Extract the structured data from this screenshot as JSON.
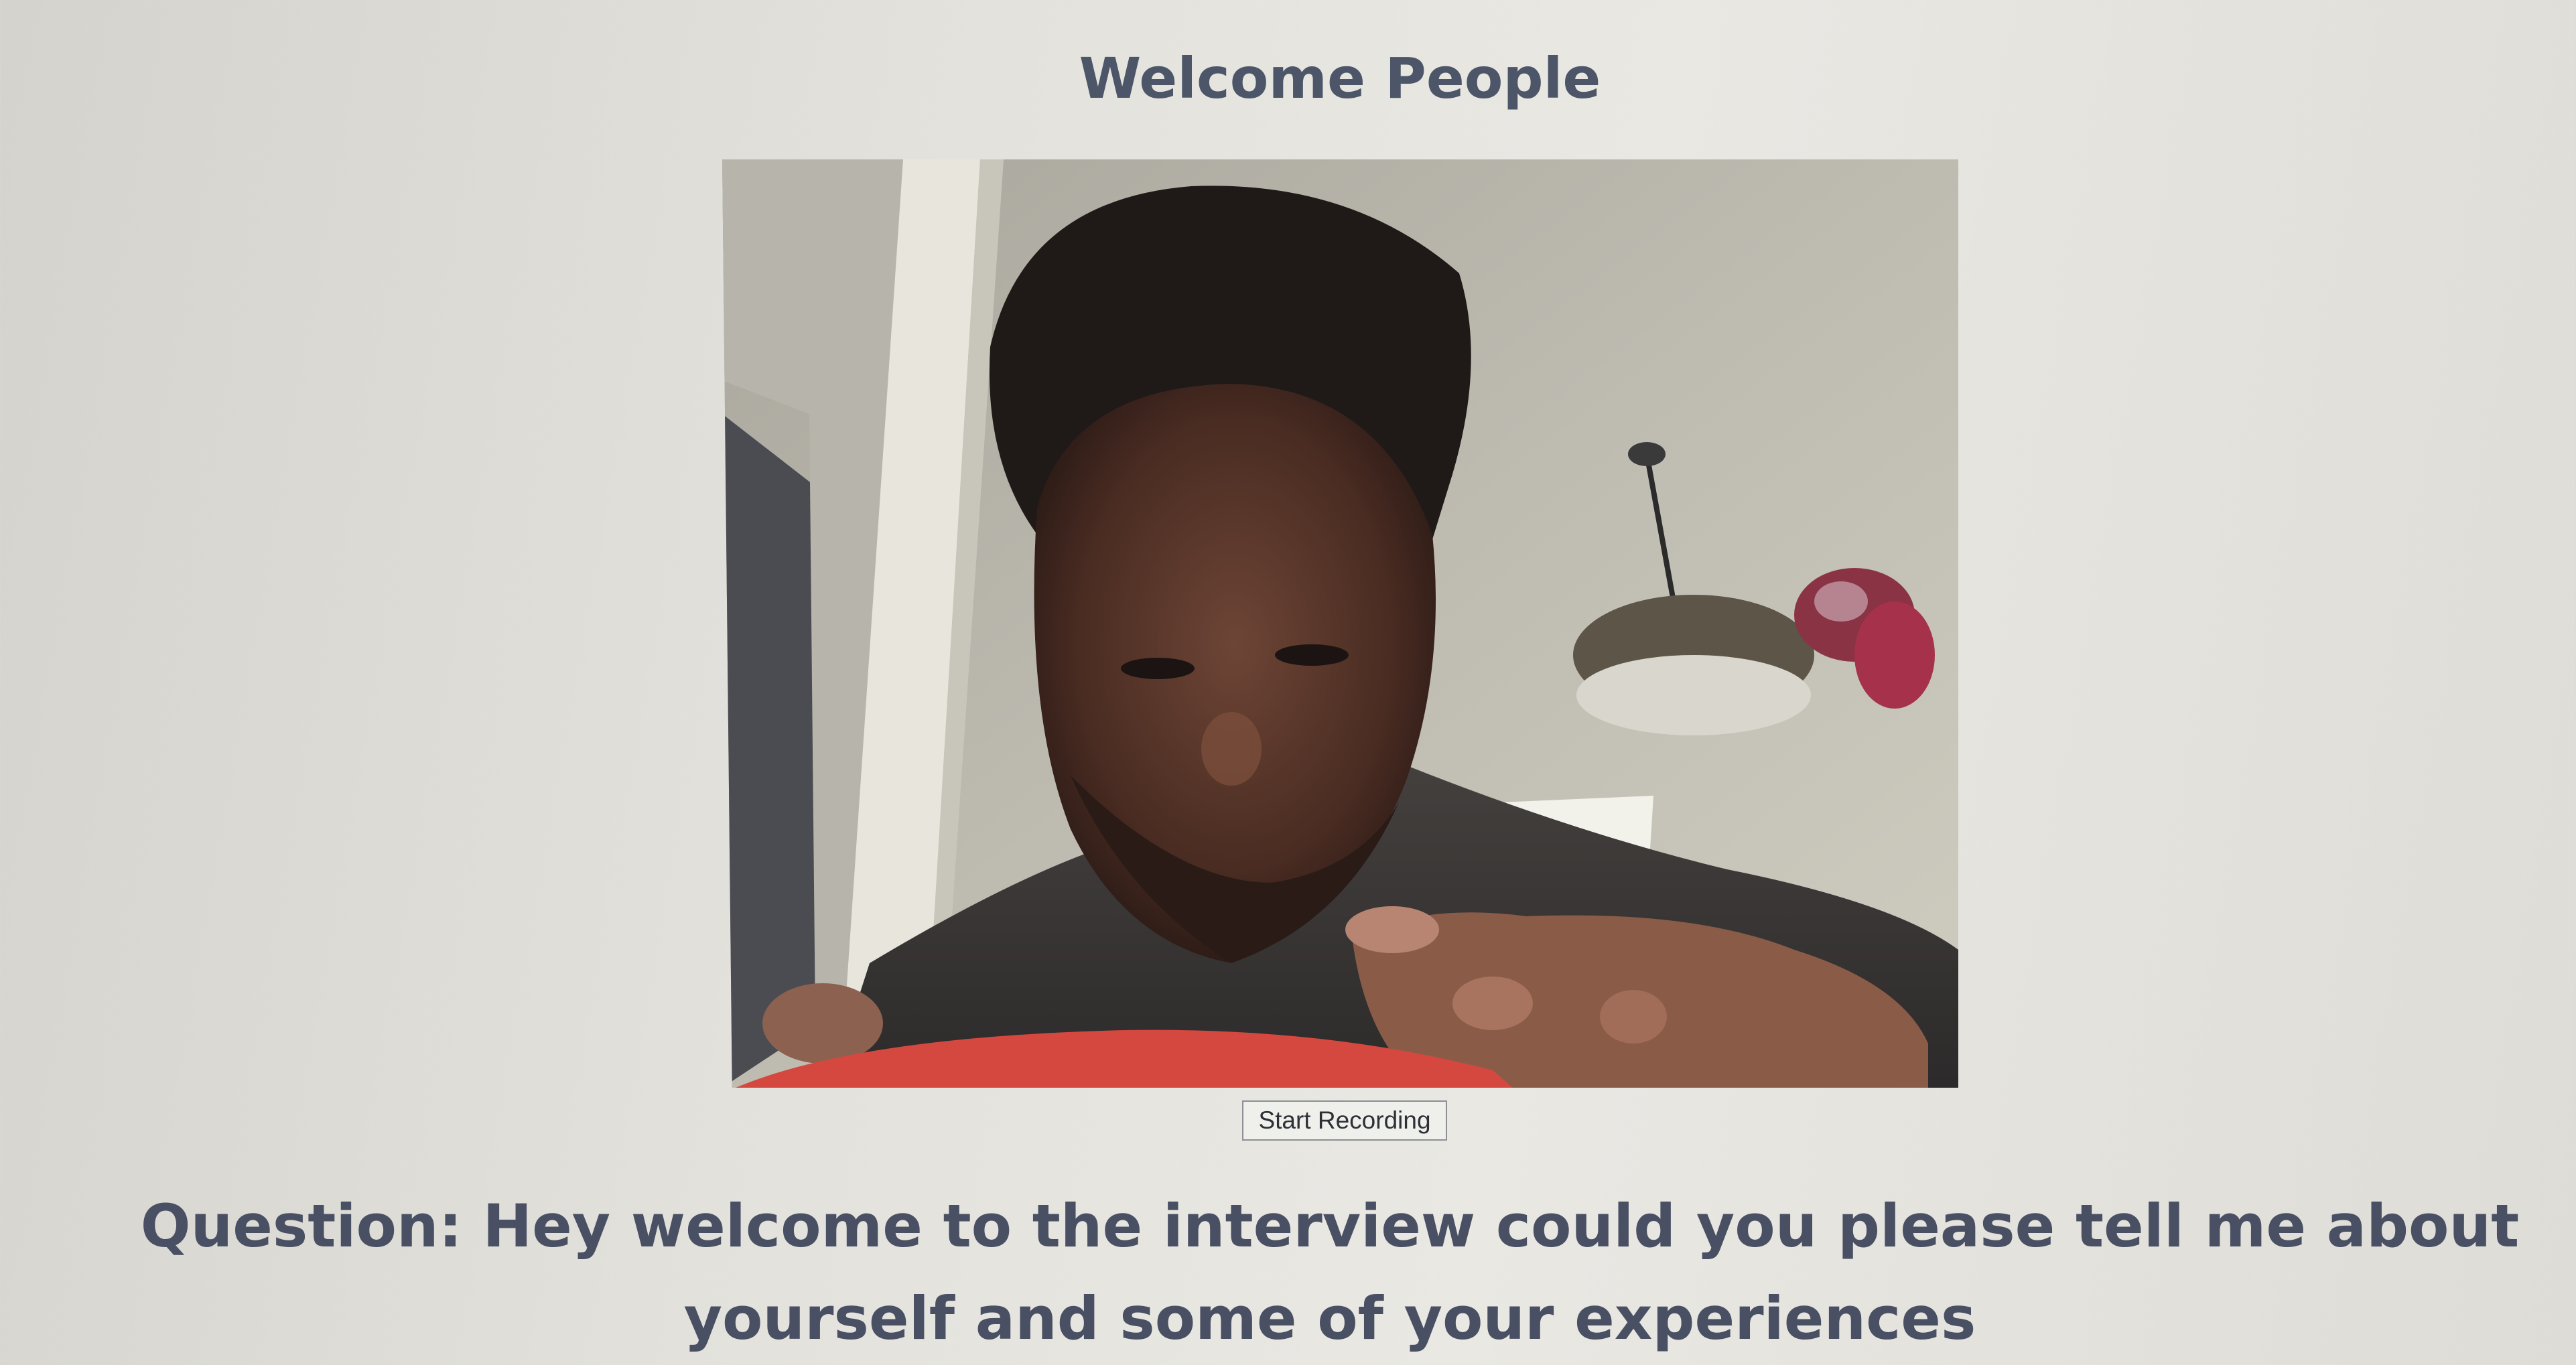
{
  "page": {
    "title": "Welcome People",
    "record_button_label": "Start Recording",
    "question_text": "Question: Hey welcome to the interview could you please tell me about yourself and some of your experiences"
  },
  "colors": {
    "background": "#e3e2dc",
    "title_text": "#4d5568",
    "question_text": "#4a5063",
    "button_border": "#8d8f94"
  },
  "video": {
    "content": "webcam-feed"
  }
}
